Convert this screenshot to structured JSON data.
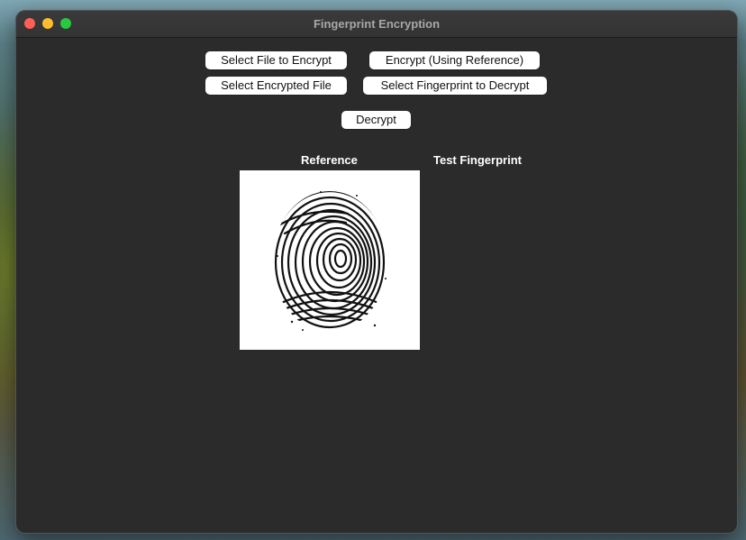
{
  "window": {
    "title": "Fingerprint Encryption"
  },
  "buttons": {
    "select_file": "Select File to Encrypt",
    "encrypt": "Encrypt (Using Reference)",
    "select_encrypted": "Select Encrypted File",
    "select_fingerprint": "Select Fingerprint to Decrypt",
    "decrypt": "Decrypt"
  },
  "panels": {
    "reference_label": "Reference",
    "test_label": "Test Fingerprint"
  },
  "colors": {
    "window_bg": "#2b2b2b",
    "close": "#ff5f57",
    "minimize": "#febc2e",
    "maximize": "#28c840"
  }
}
